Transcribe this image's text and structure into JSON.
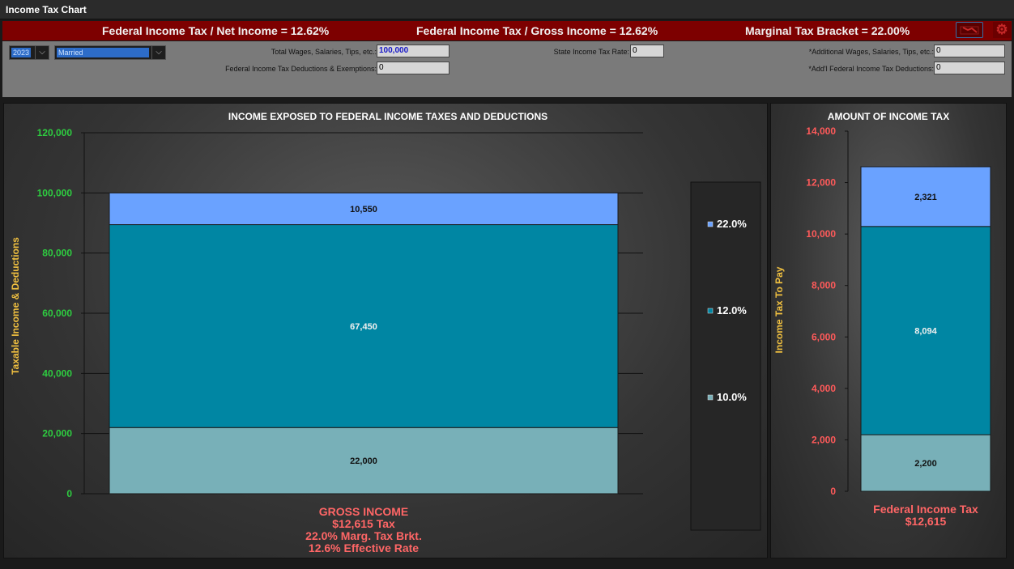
{
  "window": {
    "title": "Income Tax Chart"
  },
  "summary": {
    "net_ratio": "Federal Income Tax / Net Income = 12.62%",
    "gross_ratio": "Federal Income Tax / Gross Income = 12.62%",
    "marginal_bracket": "Marginal Tax Bracket = 22.00%"
  },
  "inputs": {
    "year": "2023",
    "filing_status": "Married",
    "wages_label": "Total Wages, Salaries, Tips, etc.:",
    "wages_value": "100,000",
    "deductions_label": "Federal Income Tax Deductions & Exemptions:",
    "deductions_value": "0",
    "state_rate_label": "State Income Tax Rate:",
    "state_rate_value": "0",
    "additional_wages_label": "*Additional Wages, Salaries, Tips, etc.:",
    "additional_wages_value": "0",
    "addl_deductions_label": "*Add'l Federal Income Tax Deductions:",
    "addl_deductions_value": "0"
  },
  "colors": {
    "bracket_10": "#78b0b8",
    "bracket_12": "#0086a3",
    "bracket_22": "#6aa2ff",
    "axis_green": "#2ecc40",
    "axis_red": "#ff5a5a",
    "axis_title_yellow": "#f0c040",
    "caption_red": "#ff6666"
  },
  "chart_data": [
    {
      "type": "bar",
      "stacked": true,
      "title": "INCOME EXPOSED TO FEDERAL INCOME TAXES AND DEDUCTIONS",
      "ylabel": "Taxable Income & Deductions",
      "ylim": [
        0,
        120000
      ],
      "yticks": [
        "0",
        "20,000",
        "40,000",
        "60,000",
        "80,000",
        "100,000",
        "120,000"
      ],
      "categories": [
        "GROSS INCOME"
      ],
      "series": [
        {
          "name": "10.0%",
          "values": [
            22000
          ],
          "label": "22,000"
        },
        {
          "name": "12.0%",
          "values": [
            67450
          ],
          "label": "67,450"
        },
        {
          "name": "22.0%",
          "values": [
            10550
          ],
          "label": "10,550"
        }
      ],
      "caption": [
        "GROSS INCOME",
        "$12,615 Tax",
        "22.0% Marg. Tax Brkt.",
        "12.6% Effective Rate"
      ],
      "legend": [
        "22.0%",
        "12.0%",
        "10.0%"
      ],
      "legend_position": "right",
      "grid": true
    },
    {
      "type": "bar",
      "stacked": true,
      "title": "AMOUNT OF INCOME TAX",
      "ylabel": "Income Tax To Pay",
      "ylim": [
        0,
        14000
      ],
      "yticks": [
        "0",
        "2,000",
        "4,000",
        "6,000",
        "8,000",
        "10,000",
        "12,000",
        "14,000"
      ],
      "categories": [
        "Federal Income Tax"
      ],
      "series": [
        {
          "name": "10.0%",
          "values": [
            2200
          ],
          "label": "2,200"
        },
        {
          "name": "12.0%",
          "values": [
            8094
          ],
          "label": "8,094"
        },
        {
          "name": "22.0%",
          "values": [
            2321
          ],
          "label": "2,321"
        }
      ],
      "caption": [
        "Federal Income Tax",
        "$12,615"
      ],
      "grid": false
    }
  ]
}
